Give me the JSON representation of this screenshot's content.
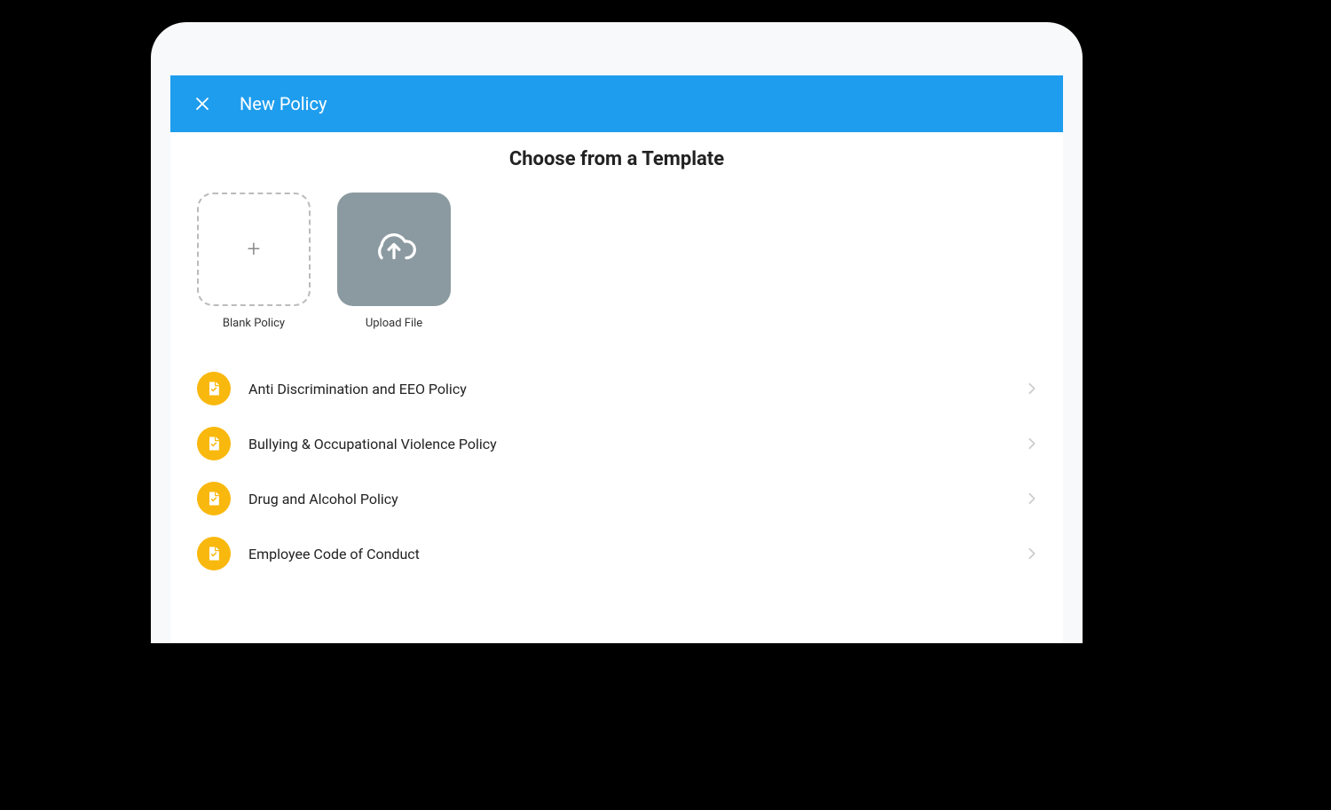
{
  "header": {
    "title": "New Policy"
  },
  "main": {
    "section_title": "Choose from a Template",
    "cards": {
      "blank_label": "Blank Policy",
      "upload_label": "Upload File"
    },
    "templates": [
      {
        "label": "Anti Discrimination and EEO Policy"
      },
      {
        "label": "Bullying & Occupational Violence Policy"
      },
      {
        "label": "Drug and Alcohol Policy"
      },
      {
        "label": "Employee Code of Conduct"
      }
    ]
  }
}
